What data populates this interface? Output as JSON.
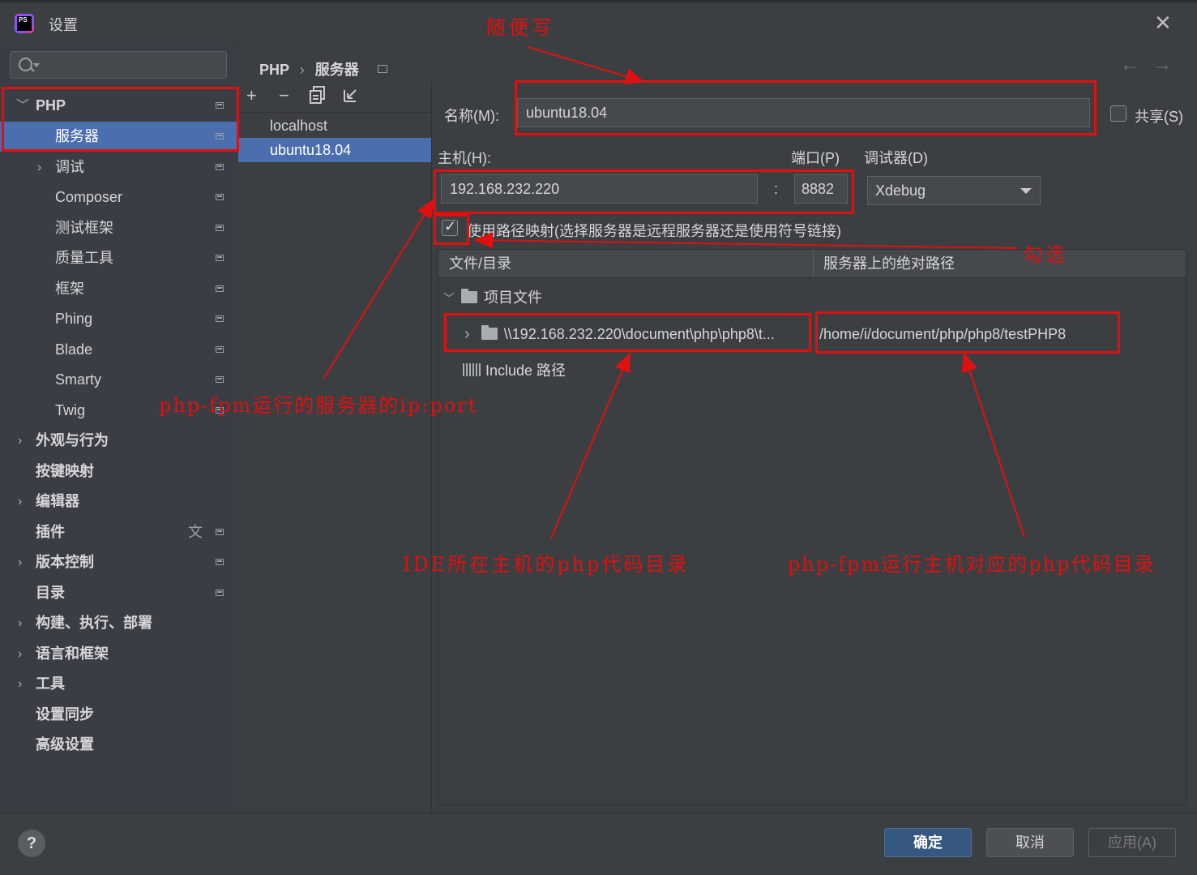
{
  "window": {
    "title": "设置"
  },
  "sidebar": {
    "search_placeholder": "",
    "items": [
      {
        "label": "PHP",
        "bold": true
      },
      {
        "label": "服务器"
      },
      {
        "label": "调试"
      },
      {
        "label": "Composer"
      },
      {
        "label": "测试框架"
      },
      {
        "label": "质量工具"
      },
      {
        "label": "框架"
      },
      {
        "label": "Phing"
      },
      {
        "label": "Blade"
      },
      {
        "label": "Smarty"
      },
      {
        "label": "Twig"
      },
      {
        "label": "外观与行为",
        "bold": true
      },
      {
        "label": "按键映射",
        "bold": true
      },
      {
        "label": "编辑器",
        "bold": true
      },
      {
        "label": "插件",
        "bold": true
      },
      {
        "label": "版本控制",
        "bold": true
      },
      {
        "label": "目录",
        "bold": true
      },
      {
        "label": "构建、执行、部署",
        "bold": true
      },
      {
        "label": "语言和框架",
        "bold": true
      },
      {
        "label": "工具",
        "bold": true
      },
      {
        "label": "设置同步",
        "bold": true
      },
      {
        "label": "高级设置",
        "bold": true
      }
    ]
  },
  "breadcrumb": {
    "parent": "PHP",
    "separator": "›",
    "current": "服务器"
  },
  "servers": {
    "toolbar": {
      "add": "+",
      "remove": "−"
    },
    "list": [
      "localhost",
      "ubuntu18.04"
    ]
  },
  "form": {
    "name_label": "名称(M):",
    "name_value": "ubuntu18.04",
    "share_label": "共享(S)",
    "host_label": "主机(H):",
    "host_value": "192.168.232.220",
    "port_label": "端口(P)",
    "port_separator": ":",
    "port_value": "8882",
    "debugger_label": "调试器(D)",
    "debugger_value": "Xdebug",
    "path_mapping_label": "使用路径映射(选择服务器是远程服务器还是使用符号链接)",
    "path_mapping_checked": true
  },
  "mapping": {
    "col_file": "文件/目录",
    "col_server": "服务器上的绝对路径",
    "project_files": "项目文件",
    "local_path": "\\\\192.168.232.220\\document\\php\\php8\\t...",
    "server_path": "/home/i/document/php/php8/testPHP8",
    "include_label": "Include 路径"
  },
  "footer": {
    "help": "?",
    "ok": "确定",
    "cancel": "取消",
    "apply": "应用(A)"
  },
  "annotations": {
    "name_note": "随便写",
    "check_note": "勾选",
    "host_note": "php-fpm运行的服务器的ip:port",
    "local_note": "IDE所在主机的php代码目录",
    "server_note": "php-fpm运行主机对应的php代码目录"
  },
  "colors": {
    "accent": "#4b6eaf",
    "annotation": "#e01010",
    "primary_button": "#365880"
  }
}
